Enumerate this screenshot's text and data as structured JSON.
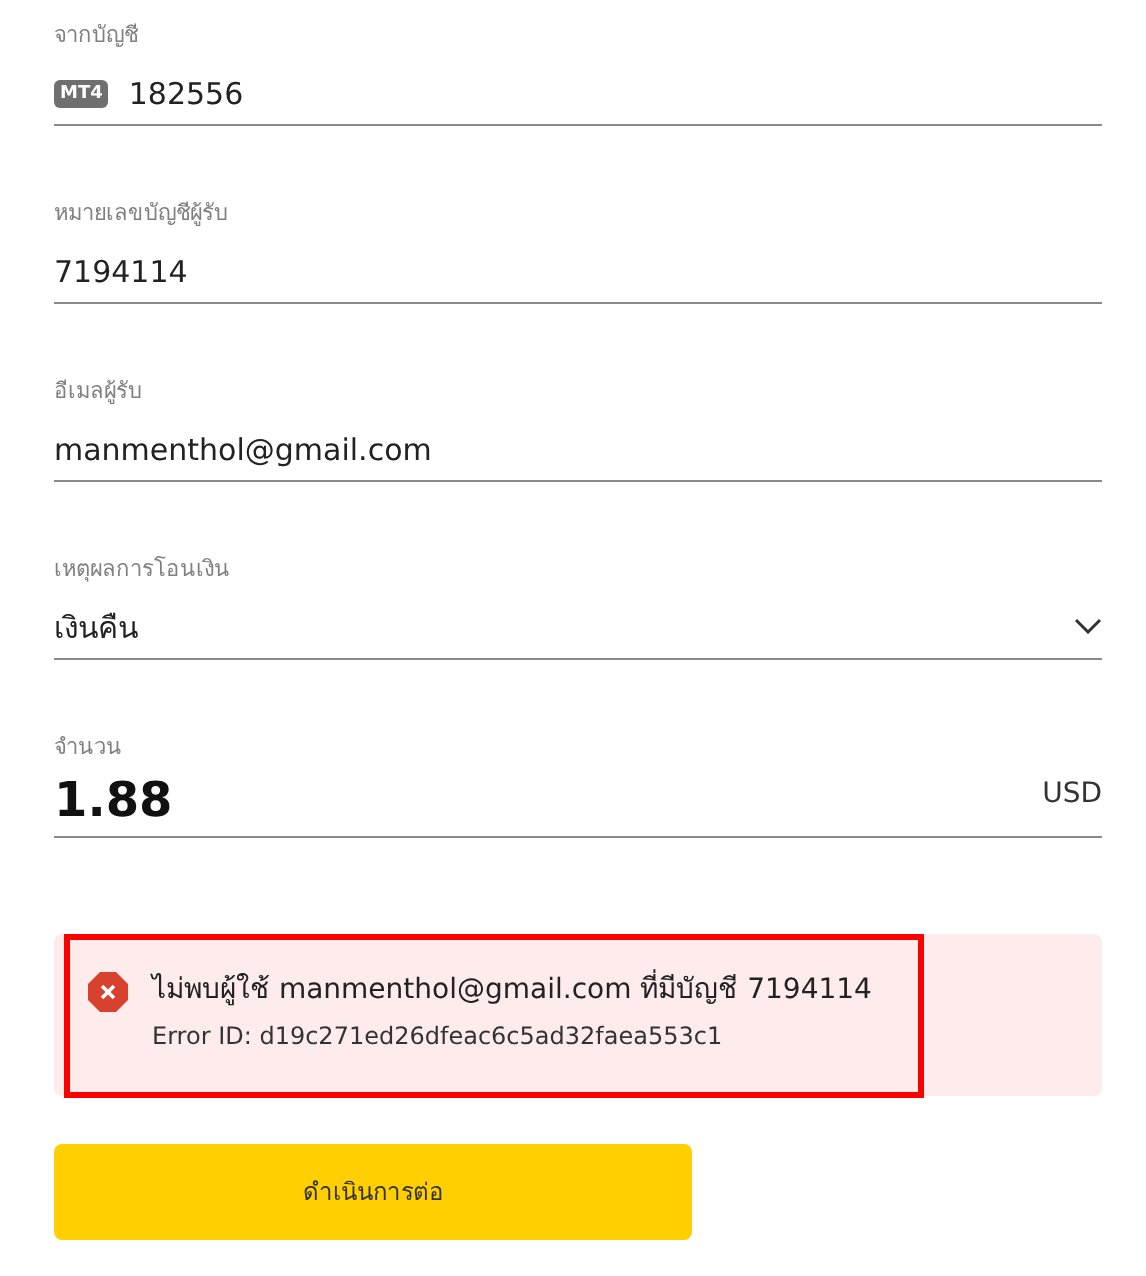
{
  "fields": [
    {
      "kind": "account",
      "label": "จากบัญชี",
      "badge": "MT4",
      "value": "182556"
    },
    {
      "kind": "text",
      "label": "หมายเลขบัญชีผู้รับ",
      "value": "7194114"
    },
    {
      "kind": "text",
      "label": "อีเมลผู้รับ",
      "value": "manmenthol@gmail.com"
    },
    {
      "kind": "select",
      "label": "เหตุผลการโอนเงิน",
      "value": "เงินคืน"
    },
    {
      "kind": "amount",
      "label": "จำนวน",
      "value": "1.88",
      "currency": "USD"
    }
  ],
  "error": {
    "message": "ไม่พบผู้ใช้ manmenthol@gmail.com ที่มีบัญชี 7194114",
    "detail": "Error ID: d19c271ed26dfeac6c5ad32faea553c1",
    "highlighted": true
  },
  "submit_button": {
    "label": "ดำเนินการต่อ"
  }
}
